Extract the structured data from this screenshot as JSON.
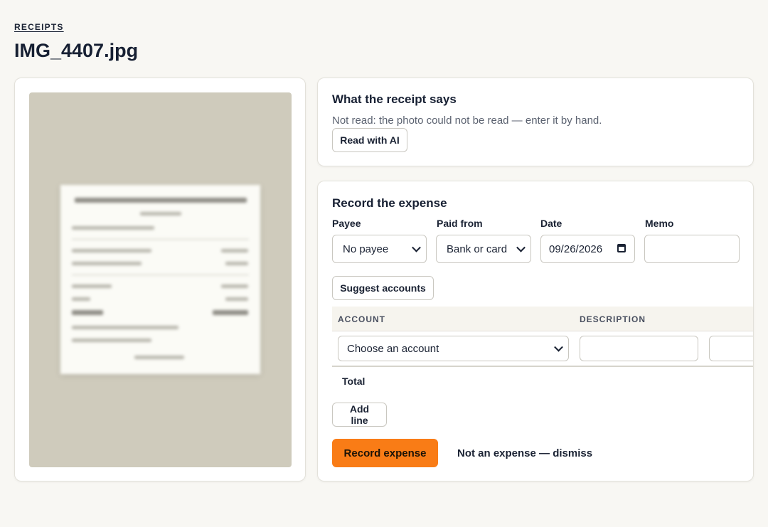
{
  "breadcrumb": "RECEIPTS",
  "page_title": "IMG_4407.jpg",
  "reading": {
    "title": "What the receipt says",
    "status": "Not read: the photo could not be read — enter it by hand.",
    "read_button": "Read with AI"
  },
  "expense": {
    "title": "Record the expense",
    "fields": {
      "payee": {
        "label": "Payee",
        "value": "No payee"
      },
      "paid_from": {
        "label": "Paid from",
        "value": "Bank or card"
      },
      "date": {
        "label": "Date",
        "value": "09/26/2026"
      },
      "memo": {
        "label": "Memo",
        "value": ""
      }
    },
    "suggest_button": "Suggest accounts",
    "table": {
      "headers": {
        "account": "ACCOUNT",
        "description": "DESCRIPTION"
      },
      "rows": [
        {
          "account": "Choose an account",
          "description": "",
          "amount": ""
        }
      ]
    },
    "total_label": "Total",
    "add_line_button": "Add line",
    "record_button": "Record expense",
    "dismiss_link": "Not an expense — dismiss"
  },
  "colors": {
    "accent": "#f97c16",
    "background": "#f8f7f3",
    "photo_background": "#cfcbbc"
  },
  "icons": {
    "select_chevron": "chevron-down-icon",
    "date_picker": "calendar-icon"
  }
}
